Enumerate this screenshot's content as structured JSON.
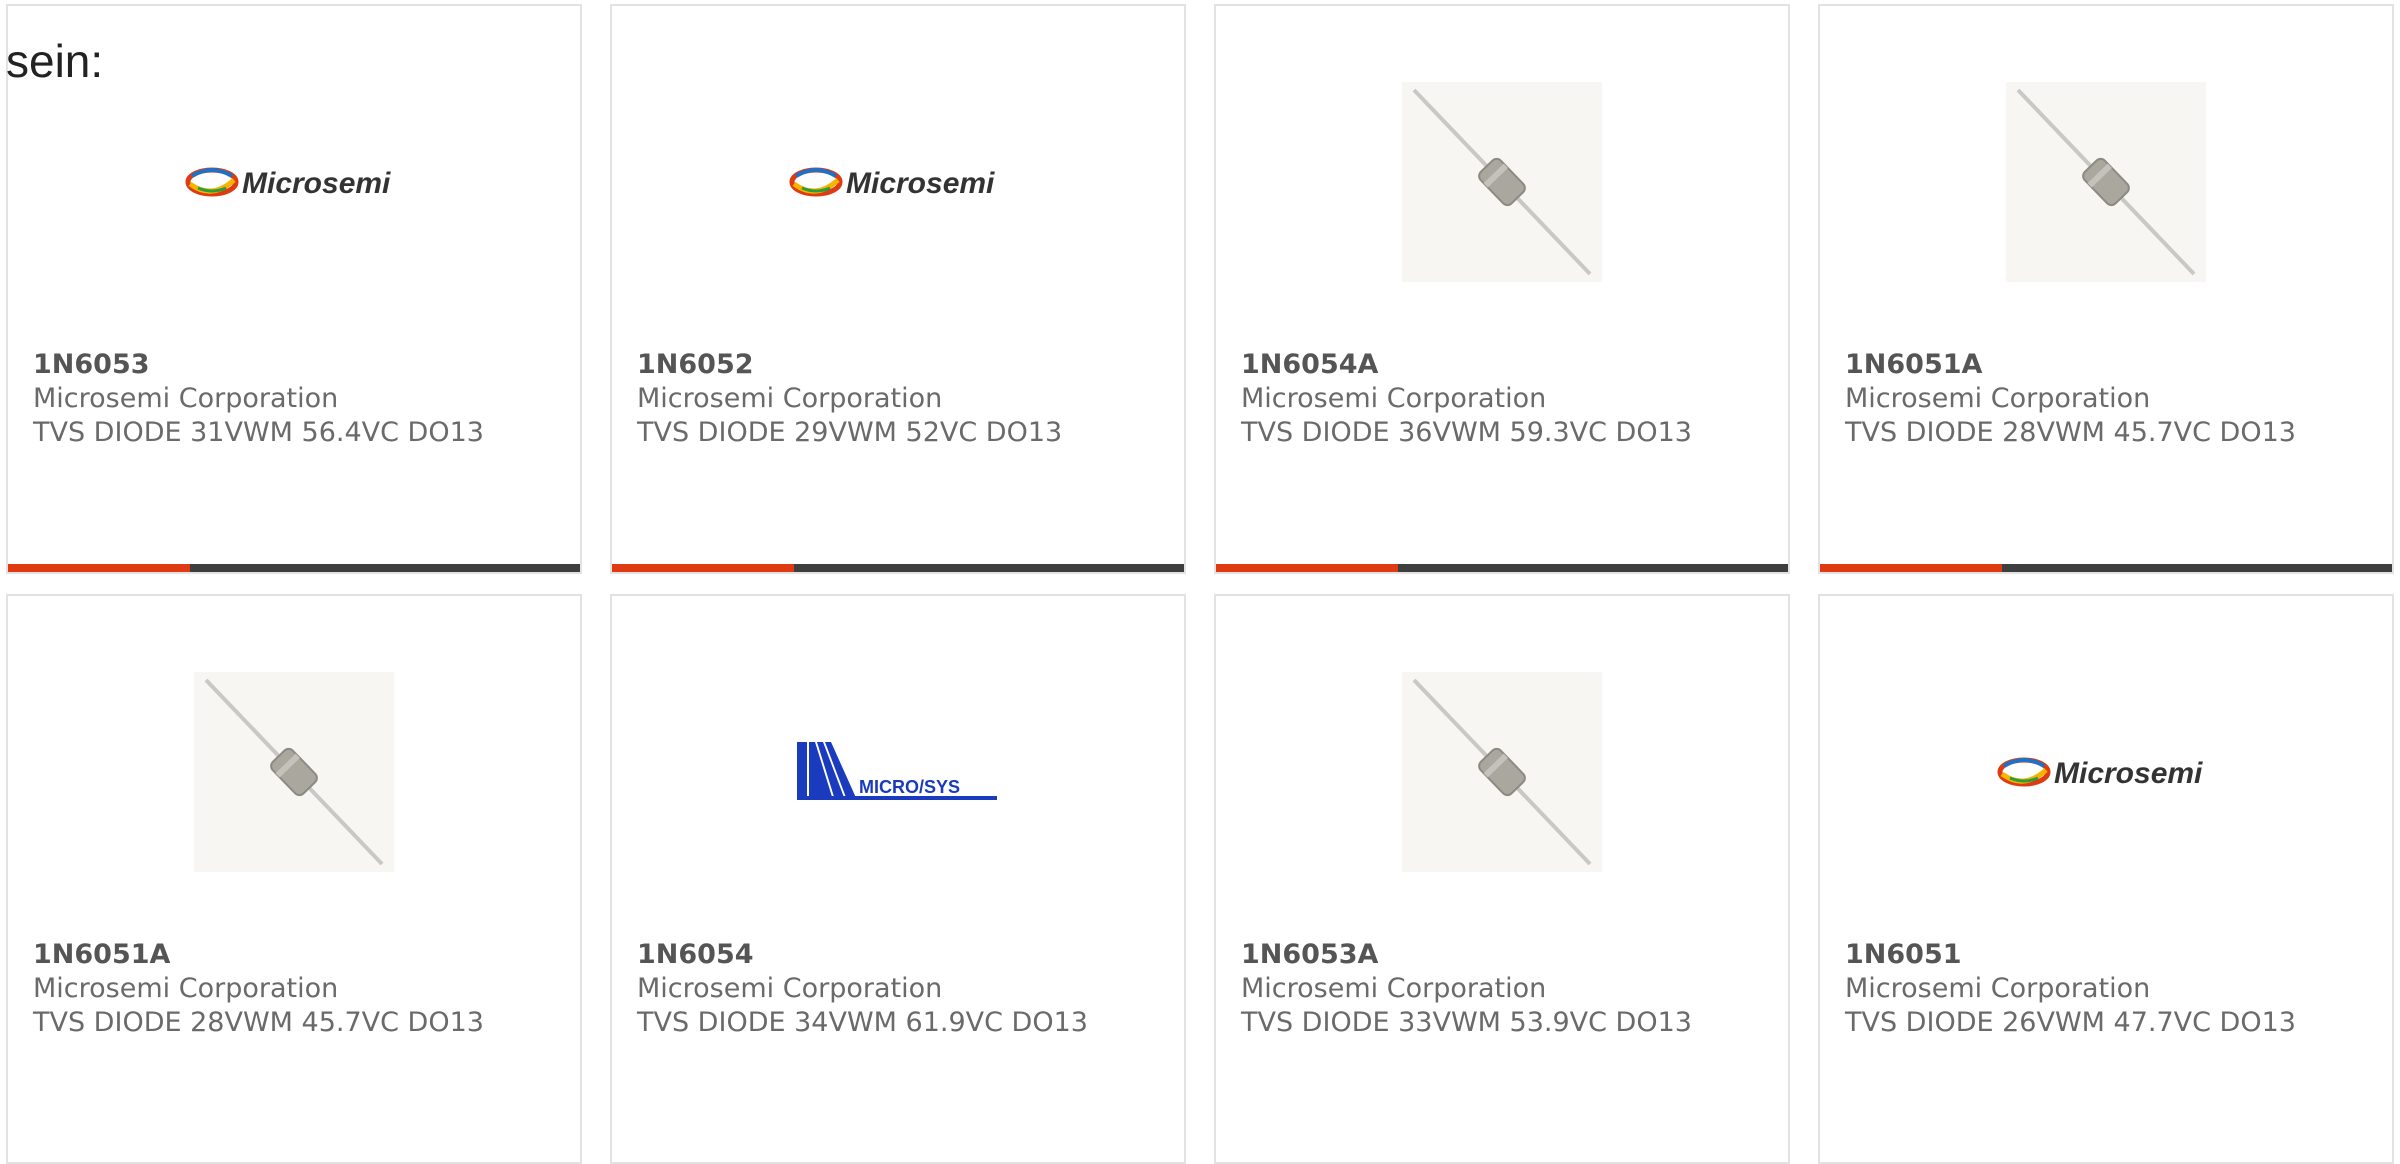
{
  "intro_text": "sein:",
  "colors": {
    "accent": "#e03a12",
    "bar": "#3e3e3e",
    "card_border": "#e2e2e2",
    "text": "#6a6a6a",
    "microsys_blue": "#1a3bbd"
  },
  "cards": [
    {
      "part_number": "1N6053",
      "manufacturer": "Microsemi Corporation",
      "description": "TVS DIODE 31VWM 56.4VC DO13",
      "image": "microsemi-logo",
      "logo_text": "Microsemi"
    },
    {
      "part_number": "1N6052",
      "manufacturer": "Microsemi Corporation",
      "description": "TVS DIODE 29VWM 52VC DO13",
      "image": "microsemi-logo",
      "logo_text": "Microsemi"
    },
    {
      "part_number": "1N6054A",
      "manufacturer": "Microsemi Corporation",
      "description": "TVS DIODE 36VWM 59.3VC DO13",
      "image": "diode-photo"
    },
    {
      "part_number": "1N6051A",
      "manufacturer": "Microsemi Corporation",
      "description": "TVS DIODE 28VWM 45.7VC DO13",
      "image": "diode-photo"
    },
    {
      "part_number": "1N6051A",
      "manufacturer": "Microsemi Corporation",
      "description": "TVS DIODE 28VWM 45.7VC DO13",
      "image": "diode-photo"
    },
    {
      "part_number": "1N6054",
      "manufacturer": "Microsemi Corporation",
      "description": "TVS DIODE 34VWM 61.9VC DO13",
      "image": "microsys-logo",
      "logo_text": "MICRO/SYS"
    },
    {
      "part_number": "1N6053A",
      "manufacturer": "Microsemi Corporation",
      "description": "TVS DIODE 33VWM 53.9VC DO13",
      "image": "diode-photo"
    },
    {
      "part_number": "1N6051",
      "manufacturer": "Microsemi Corporation",
      "description": "TVS DIODE 26VWM 47.7VC DO13",
      "image": "microsemi-logo",
      "logo_text": "Microsemi"
    }
  ]
}
